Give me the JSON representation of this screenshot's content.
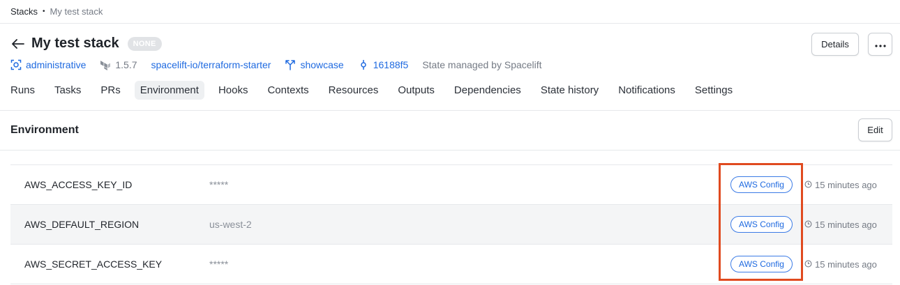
{
  "breadcrumb": {
    "root": "Stacks",
    "separator": "•",
    "current": "My test stack"
  },
  "header": {
    "title": "My test stack",
    "status": "NONE",
    "details_label": "Details",
    "more_label": "•••"
  },
  "meta": {
    "space": "administrative",
    "terraform_version": "1.5.7",
    "repository": "spacelift-io/terraform-starter",
    "branch": "showcase",
    "commit": "16188f5",
    "state": "State managed by Spacelift"
  },
  "tabs": [
    "Runs",
    "Tasks",
    "PRs",
    "Environment",
    "Hooks",
    "Contexts",
    "Resources",
    "Outputs",
    "Dependencies",
    "State history",
    "Notifications",
    "Settings"
  ],
  "active_tab": "Environment",
  "section": {
    "title": "Environment",
    "edit_label": "Edit"
  },
  "env_vars": [
    {
      "name": "AWS_ACCESS_KEY_ID",
      "value": "*****",
      "context": "AWS Config",
      "time": "15 minutes ago"
    },
    {
      "name": "AWS_DEFAULT_REGION",
      "value": "us-west-2",
      "context": "AWS Config",
      "time": "15 minutes ago"
    },
    {
      "name": "AWS_SECRET_ACCESS_KEY",
      "value": "*****",
      "context": "AWS Config",
      "time": "15 minutes ago"
    }
  ],
  "colors": {
    "link": "#1f6ae0",
    "highlight": "#e04a1f",
    "badge_bg": "#e1e3e6",
    "active_tab_bg": "#eef0f2"
  }
}
